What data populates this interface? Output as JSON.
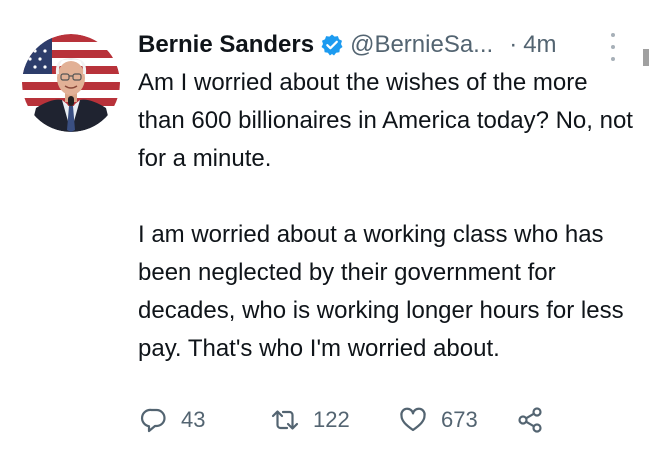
{
  "tweet": {
    "author_name": "Bernie Sanders",
    "handle": "@BernieSa...",
    "separator": "·",
    "time": "4m",
    "paragraphs": [
      "Am I worried about the wishes of the more than 600 billionaires in America today? No, not for a minute.",
      "I am worried about a working class who has been neglected by their government for decades, who is working longer hours for less pay. That's who I'm worried about."
    ],
    "actions": {
      "replies": "43",
      "retweets": "122",
      "likes": "673"
    }
  },
  "icons": {
    "verified": "verified-badge-icon",
    "more": "more-vertical-icon",
    "reply": "reply-icon",
    "retweet": "retweet-icon",
    "like": "heart-icon",
    "share": "share-icon"
  },
  "colors": {
    "text": "#0f1419",
    "secondary": "#536471",
    "verified": "#1d9bf0"
  }
}
